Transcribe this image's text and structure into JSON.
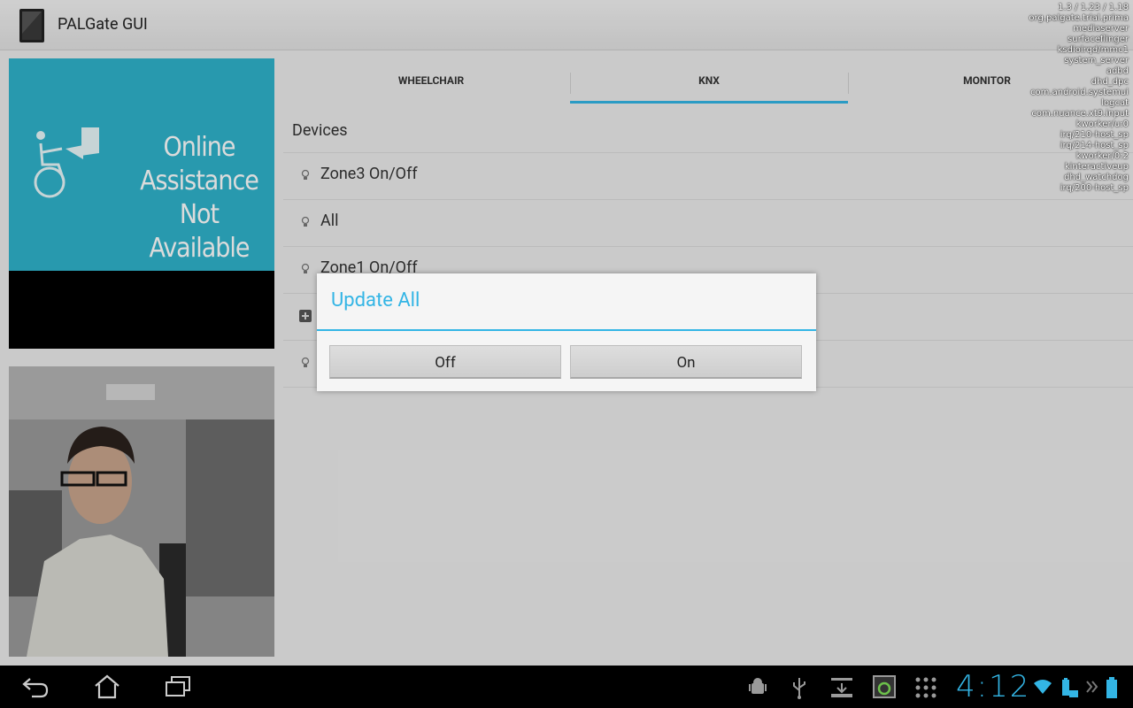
{
  "app": {
    "title": "PALGate GUI"
  },
  "assist": {
    "line1": "Online Assistance",
    "line2": "Not Available"
  },
  "tabs": [
    {
      "label": "WHEELCHAIR"
    },
    {
      "label": "KNX",
      "selected": true
    },
    {
      "label": "MONITOR"
    }
  ],
  "devices": {
    "title": "Devices",
    "items": [
      {
        "label": "Zone3 On/Off",
        "icon": "lightbulb-icon"
      },
      {
        "label": "All",
        "icon": "lightbulb-icon"
      },
      {
        "label": "Zone1 On/Off",
        "icon": "lightbulb-icon"
      },
      {
        "label": "",
        "icon": "plus-box-icon"
      },
      {
        "label": "",
        "icon": "lightbulb-icon"
      }
    ]
  },
  "dialog": {
    "title": "Update All",
    "buttons": {
      "off": "Off",
      "on": "On"
    }
  },
  "debug": {
    "load": "1.3 / 1.23 / 1.18",
    "processes": [
      "org.palgate.trial.prima",
      "mediaserver",
      "surfaceflinger",
      "ksdioirqd/mmc1",
      "system_server",
      "adbd",
      "dhd_dpc",
      "com.android.systemui",
      "logcat",
      "com.nuance.xt9.input",
      "kworker/u:0",
      "irq/210-host_sp",
      "irq/214-host_sp",
      "kworker/0:2",
      "kinteractiveup",
      "dhd_watchdog",
      "irq/200-host_sp"
    ]
  },
  "systembar": {
    "clock": "4:12"
  },
  "colors": {
    "accent": "#33b5e5",
    "assist_bg": "#2fb3cb"
  }
}
